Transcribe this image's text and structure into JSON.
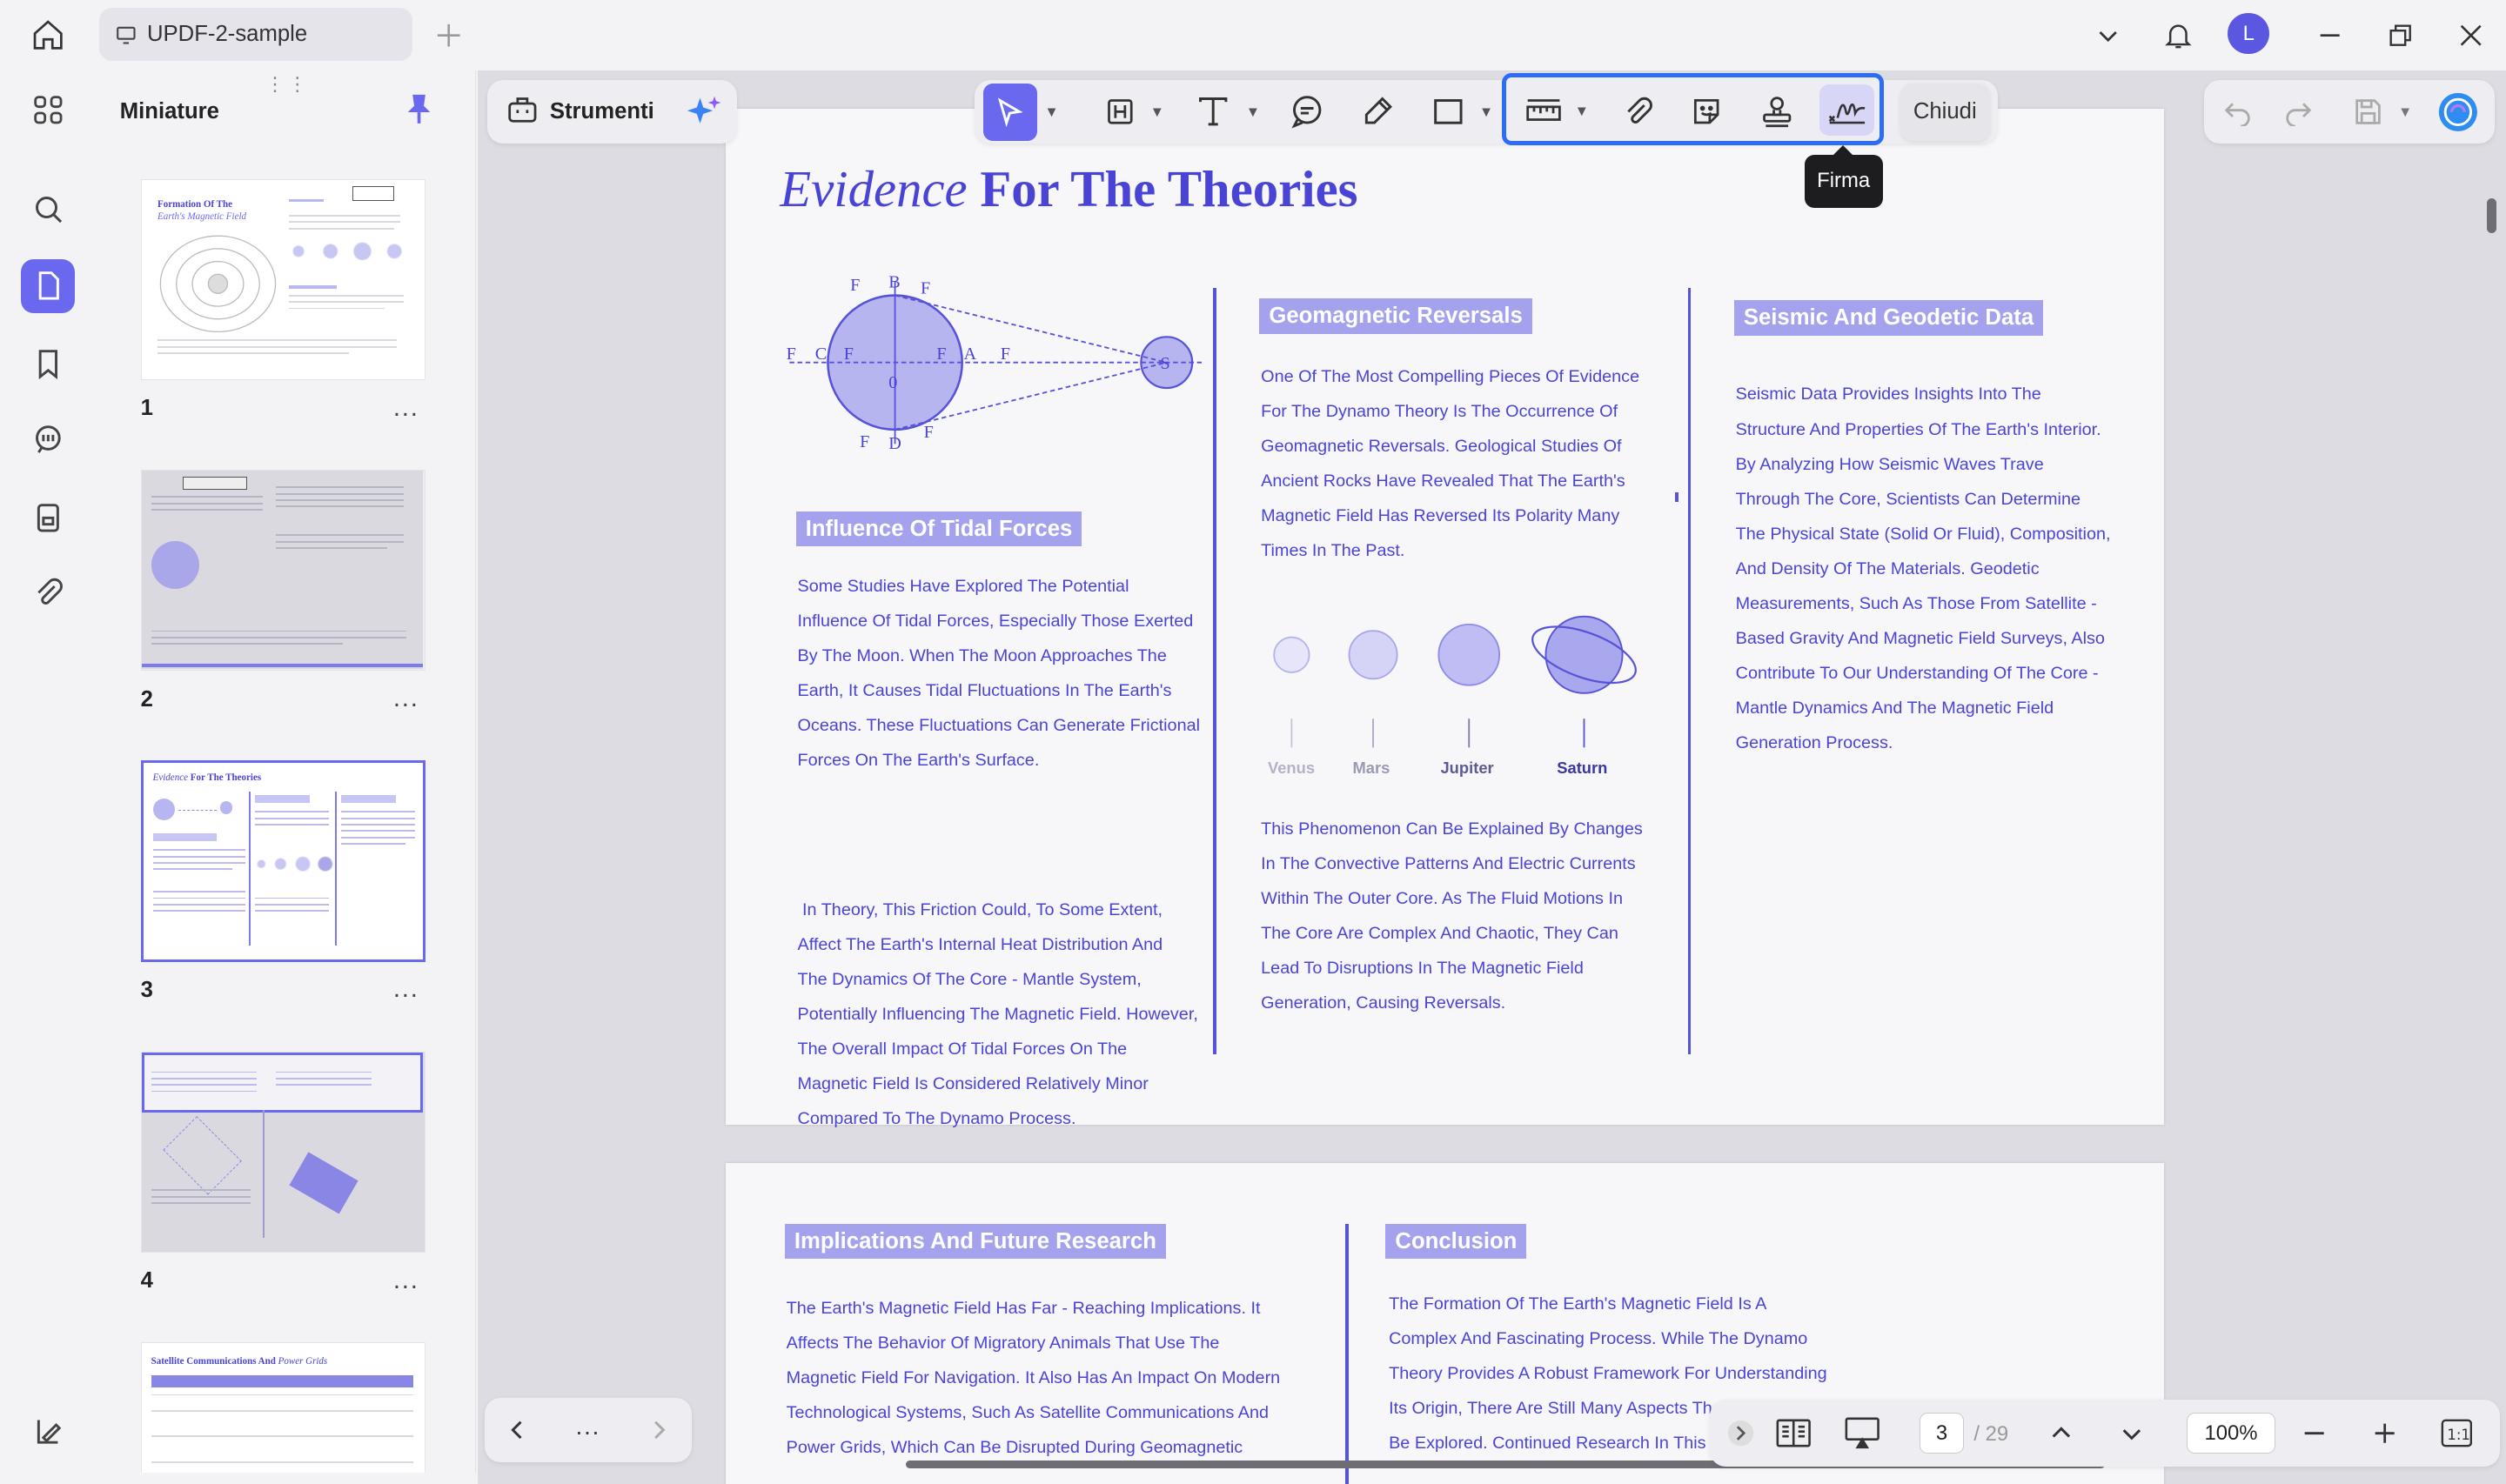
{
  "window": {
    "tab_title": "UPDF-2-sample",
    "avatar_letter": "L"
  },
  "thumbnail_panel": {
    "title": "Miniature",
    "pages": [
      {
        "number": "1",
        "title_a": "Formation Of The",
        "title_b": "Earth's Magnetic Field"
      },
      {
        "number": "2"
      },
      {
        "number": "3",
        "title_a": "Evidence",
        "title_b": "For The Theories"
      },
      {
        "number": "4"
      },
      {
        "title_a": "Satellite Communications And",
        "title_b": "Power Grids"
      }
    ],
    "more": "..."
  },
  "tools_panel": {
    "label": "Strumenti"
  },
  "toolbar": {
    "close_label": "Chiudi",
    "tooltip": "Firma"
  },
  "page3": {
    "title_italic": "Evidence",
    "title_bold": "For The Theories",
    "diagram_labels": {
      "b": "B",
      "d": "D",
      "c": "C",
      "a": "A",
      "zero": "0",
      "s": "S",
      "f": "F"
    },
    "tidal": {
      "heading": "Influence Of Tidal Forces",
      "p1": [
        "Some Studies Have Explored The Potential",
        "Influence Of Tidal Forces, Especially Those Exerted",
        "By The Moon. When The Moon Approaches The",
        "Earth, It Causes Tidal Fluctuations In The Earth's",
        "Oceans. These Fluctuations Can Generate Frictional",
        "Forces On The Earth's Surface."
      ],
      "p2": [
        " In Theory, This Friction Could, To Some Extent,",
        "Affect The Earth's Internal Heat Distribution And",
        "The Dynamics Of The Core - Mantle System,",
        "Potentially Influencing The Magnetic Field. However,",
        "The Overall Impact Of Tidal Forces On The",
        "Magnetic Field Is Considered Relatively Minor",
        "Compared To The Dynamo Process."
      ]
    },
    "reversals": {
      "heading": "Geomagnetic Reversals",
      "p1": [
        "One Of The Most Compelling Pieces Of Evidence",
        "For The Dynamo Theory Is The Occurrence Of",
        "Geomagnetic Reversals. Geological Studies Of",
        "Ancient Rocks Have Revealed That The Earth's",
        "Magnetic Field Has Reversed Its Polarity Many",
        "Times In The Past."
      ],
      "planets": [
        "Venus",
        "Mars",
        "Jupiter",
        "Saturn"
      ],
      "p2": [
        "This Phenomenon Can Be Explained By Changes",
        "In The Convective Patterns And Electric Currents",
        "Within The Outer Core. As The Fluid Motions In",
        "The Core Are Complex And Chaotic, They Can",
        "Lead To Disruptions In The Magnetic Field",
        "Generation, Causing Reversals."
      ]
    },
    "seismic": {
      "heading": "Seismic And Geodetic Data",
      "p1": [
        "Seismic Data Provides Insights Into The",
        "Structure And Properties Of The Earth's Interior.",
        "By Analyzing How Seismic Waves Trave",
        "Through The Core, Scientists Can Determine",
        "The Physical State (Solid Or Fluid), Composition,",
        "And Density Of The Materials. Geodetic",
        "Measurements, Such As Those From Satellite -",
        "Based Gravity And Magnetic Field Surveys, Also",
        "Contribute To Our Understanding Of The Core -",
        "Mantle Dynamics And The Magnetic Field",
        "Generation Process."
      ]
    }
  },
  "page4": {
    "implications": {
      "heading": "Implications And Future Research",
      "p1": [
        "The Earth's Magnetic Field Has Far - Reaching Implications. It",
        "Affects The Behavior Of Migratory Animals That Use The",
        "Magnetic Field For Navigation. It Also Has An Impact On Modern",
        "Technological Systems, Such As Satellite Communications And",
        "Power Grids, Which Can Be Disrupted During Geomagnetic"
      ]
    },
    "conclusion": {
      "heading": "Conclusion",
      "p1": [
        "The Formation Of The Earth's Magnetic Field Is A",
        "Complex And Fascinating Process. While The Dynamo",
        "Theory Provides A Robust Framework For Understanding",
        "Its Origin, There Are Still Many Aspects That",
        "Be Explored. Continued Research In This Ar"
      ]
    }
  },
  "bottom_nav": {
    "more": "...",
    "current_page": "3",
    "total_pages": "/ 29",
    "zoom": "100%"
  }
}
